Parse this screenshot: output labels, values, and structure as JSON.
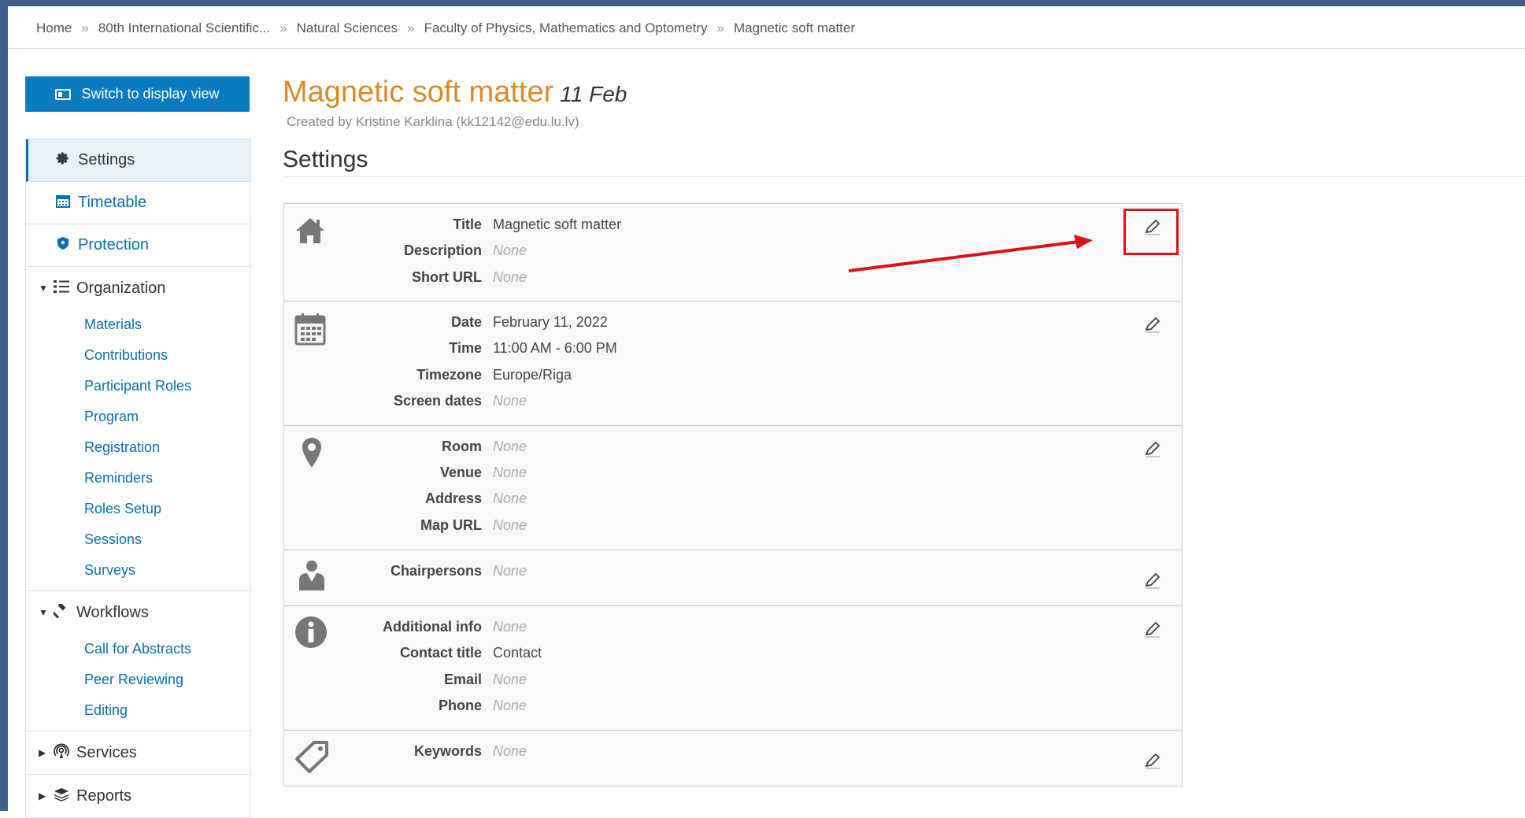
{
  "breadcrumb": {
    "items": [
      "Home",
      "80th International Scientific...",
      "Natural Sciences",
      "Faculty of Physics, Mathematics and Optometry",
      "Magnetic soft matter"
    ],
    "separator": "»"
  },
  "sidebar": {
    "switch_label": "Switch to display view",
    "settings": "Settings",
    "timetable": "Timetable",
    "protection": "Protection",
    "organization": {
      "label": "Organization",
      "items": [
        "Materials",
        "Contributions",
        "Participant Roles",
        "Program",
        "Registration",
        "Reminders",
        "Roles Setup",
        "Sessions",
        "Surveys"
      ]
    },
    "workflows": {
      "label": "Workflows",
      "items": [
        "Call for Abstracts",
        "Peer Reviewing",
        "Editing"
      ]
    },
    "services": "Services",
    "reports": "Reports"
  },
  "header": {
    "title": "Magnetic soft matter",
    "date": "11 Feb",
    "created_by": "Created by Kristine Karklina (kk12142@edu.lu.lv)",
    "section_title": "Settings"
  },
  "sections": {
    "general": [
      {
        "label": "Title",
        "value": "Magnetic soft matter"
      },
      {
        "label": "Description",
        "value": "None"
      },
      {
        "label": "Short URL",
        "value": "None"
      }
    ],
    "datetime": [
      {
        "label": "Date",
        "value": "February 11, 2022"
      },
      {
        "label": "Time",
        "value": "11:00 AM - 6:00 PM"
      },
      {
        "label": "Timezone",
        "value": "Europe/Riga"
      },
      {
        "label": "Screen dates",
        "value": "None"
      }
    ],
    "location": [
      {
        "label": "Room",
        "value": "None"
      },
      {
        "label": "Venue",
        "value": "None"
      },
      {
        "label": "Address",
        "value": "None"
      },
      {
        "label": "Map URL",
        "value": "None"
      }
    ],
    "persons": [
      {
        "label": "Chairpersons",
        "value": "None"
      }
    ],
    "info": [
      {
        "label": "Additional info",
        "value": "None"
      },
      {
        "label": "Contact title",
        "value": "Contact"
      },
      {
        "label": "Email",
        "value": "None"
      },
      {
        "label": "Phone",
        "value": "None"
      }
    ],
    "keywords": [
      {
        "label": "Keywords",
        "value": "None"
      }
    ]
  },
  "colors": {
    "accent": "#0b7bc1",
    "title": "#d98a2b",
    "annotation": "#e0101a"
  }
}
